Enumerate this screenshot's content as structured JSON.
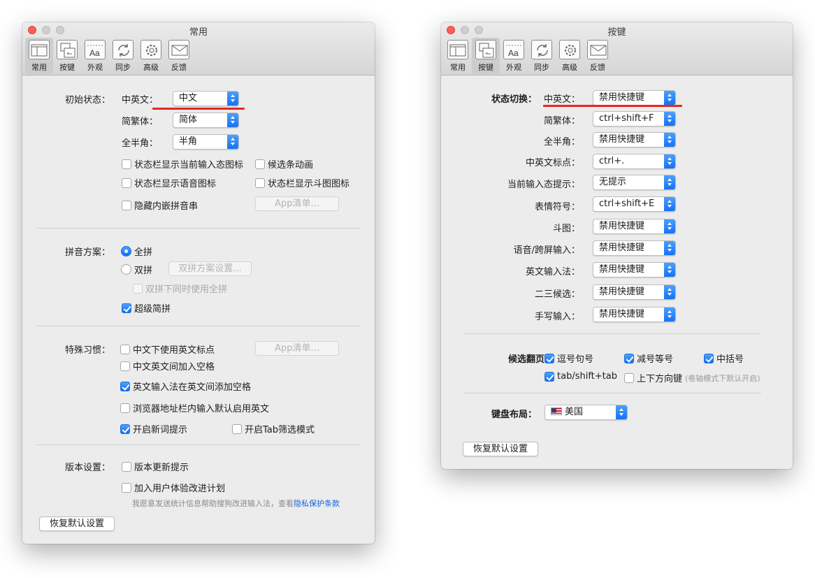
{
  "toolbar_items": [
    {
      "label": "常用",
      "icon": "general-icon"
    },
    {
      "label": "按键",
      "icon": "keys-icon"
    },
    {
      "label": "外观",
      "icon": "appearance-icon"
    },
    {
      "label": "同步",
      "icon": "sync-icon"
    },
    {
      "label": "高级",
      "icon": "gear-icon"
    },
    {
      "label": "反馈",
      "icon": "envelope-icon"
    }
  ],
  "left": {
    "title": "常用",
    "selected_tab": "常用",
    "initial_state": {
      "section_label": "初始状态：",
      "lang_label": "中英文：",
      "lang_value": "中文",
      "script_label": "简繁体：",
      "script_value": "简体",
      "width_label": "全半角：",
      "width_value": "半角",
      "cb_statusbar_icon": "状态栏显示当前输入态图标",
      "cb_candidate_anim": "候选条动画",
      "cb_statusbar_voice": "状态栏显示语音图标",
      "cb_statusbar_doutu": "状态栏显示斗图图标",
      "cb_hide_inline": "隐藏内嵌拼音串",
      "app_list_button": "App清单..."
    },
    "pinyin": {
      "section_label": "拼音方案：",
      "full": "全拼",
      "double": "双拼",
      "double_settings_button": "双拼方案设置...",
      "double_use_full": "双拼下同时使用全拼",
      "super_jianpin": "超级简拼"
    },
    "habits": {
      "section_label": "特殊习惯：",
      "cb_en_punct": "中文下使用英文标点",
      "app_list_button": "App清单...",
      "cb_space_between": "中文英文间加入空格",
      "cb_en_ime_space": "英文输入法在英文间添加空格",
      "cb_browser_en": "浏览器地址栏内输入默认启用英文",
      "cb_new_word": "开启新词提示",
      "cb_tab_filter": "开启Tab筛选模式"
    },
    "version": {
      "section_label": "版本设置：",
      "cb_update": "版本更新提示",
      "cb_ux_plan": "加入用户体验改进计划",
      "note": "我愿意发送统计信息帮助搜狗改进输入法，查看",
      "privacy_link": "隐私保护条款"
    },
    "restore_button": "恢复默认设置"
  },
  "right": {
    "title": "按键",
    "selected_tab": "按键",
    "state_switch_label": "状态切换：",
    "rows": [
      {
        "label": "中英文：",
        "value": "禁用快捷键"
      },
      {
        "label": "简繁体：",
        "value": "ctrl+shift+F"
      },
      {
        "label": "全半角：",
        "value": "禁用快捷键"
      },
      {
        "label": "中英文标点：",
        "value": "ctrl+."
      },
      {
        "label": "当前输入态提示：",
        "value": "无提示"
      },
      {
        "label": "表情符号：",
        "value": "ctrl+shift+E"
      },
      {
        "label": "斗图：",
        "value": "禁用快捷键"
      },
      {
        "label": "语音/跨屏输入：",
        "value": "禁用快捷键"
      },
      {
        "label": "英文输入法：",
        "value": "禁用快捷键"
      },
      {
        "label": "二三候选：",
        "value": "禁用快捷键"
      },
      {
        "label": "手写输入：",
        "value": "禁用快捷键"
      }
    ],
    "paging": {
      "section_label": "候选翻页：",
      "cb_comma_period": "逗号句号",
      "cb_minus_equal": "减号等号",
      "cb_brackets": "中括号",
      "cb_tab": "tab/shift+tab",
      "cb_arrows": "上下方向键",
      "arrows_note": "(卷轴模式下默认开启)"
    },
    "keyboard": {
      "section_label": "键盘布局：",
      "value": "美国",
      "flag_icon": "us-flag-icon"
    },
    "restore_button": "恢复默认设置"
  },
  "colors": {
    "accent": "#1470f0",
    "close": "#fc5f57",
    "annotation": "#e8261c"
  }
}
